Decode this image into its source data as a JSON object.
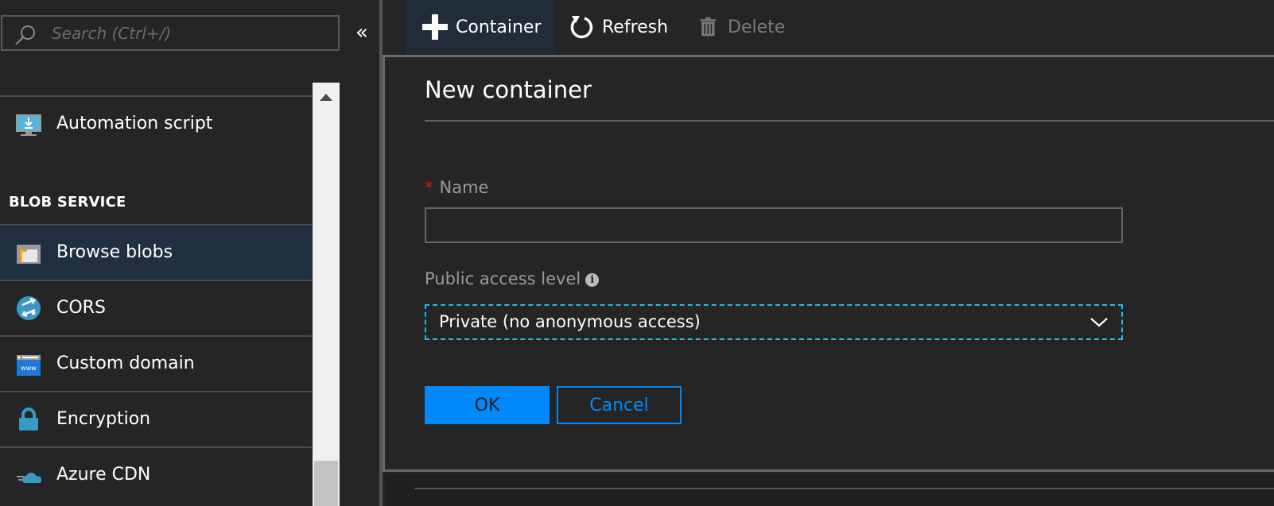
{
  "sidebar": {
    "search": {
      "placeholder": "Search (Ctrl+/)",
      "value": "",
      "icon": "search-icon"
    },
    "collapse_glyph": "«",
    "items_top": [
      {
        "label": "Automation script",
        "icon": "automation-script-icon"
      }
    ],
    "section_header": "BLOB SERVICE",
    "items": [
      {
        "label": "Browse blobs",
        "icon": "browse-blobs-icon",
        "active": true
      },
      {
        "label": "CORS",
        "icon": "cors-icon"
      },
      {
        "label": "Custom domain",
        "icon": "custom-domain-icon"
      },
      {
        "label": "Encryption",
        "icon": "lock-icon"
      },
      {
        "label": "Azure CDN",
        "icon": "cloud-cdn-icon"
      }
    ]
  },
  "toolbar": {
    "container_label": "Container",
    "refresh_label": "Refresh",
    "delete_label": "Delete"
  },
  "panel": {
    "title": "New container",
    "name_field": {
      "label": "Name",
      "required_marker": "*",
      "value": ""
    },
    "access_field": {
      "label": "Public access level",
      "info_glyph": "i",
      "selected": "Private (no anonymous access)"
    },
    "ok_label": "OK",
    "cancel_label": "Cancel"
  },
  "colors": {
    "background": "#252525",
    "accent_blue": "#0089fa",
    "focus_cyan": "#1ebbee",
    "required_red": "#e81123",
    "active_nav": "#203040"
  }
}
